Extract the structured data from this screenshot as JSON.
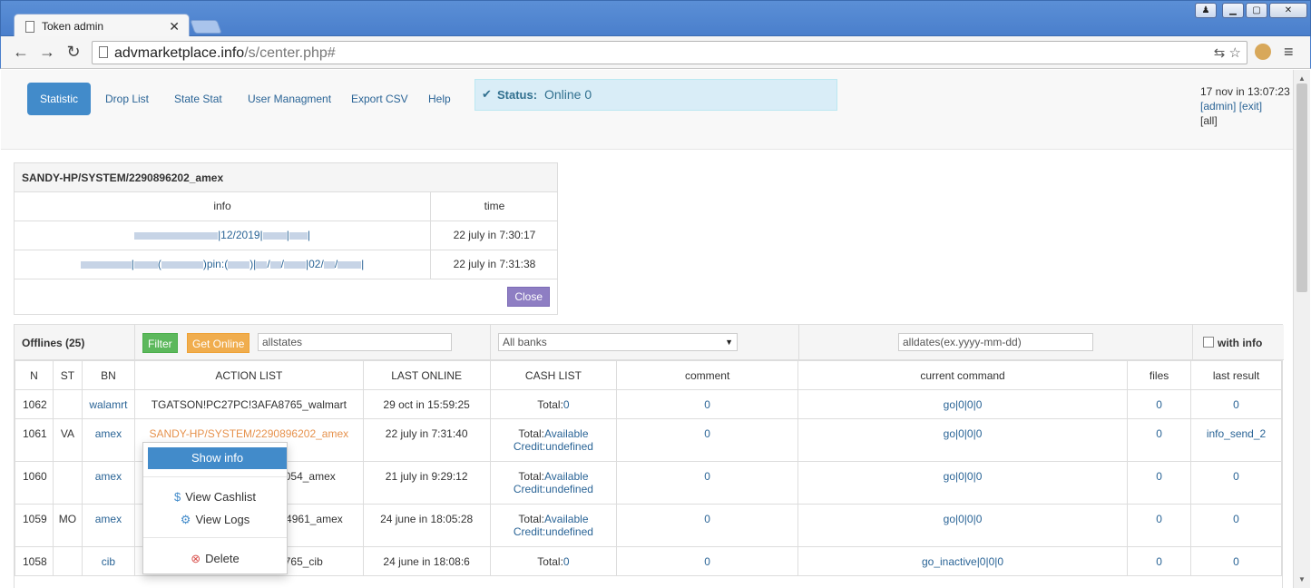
{
  "browser": {
    "tab_title": "Token admin",
    "url_host": "advmarketplace.info",
    "url_path": "/s/center.php#"
  },
  "nav": {
    "items": [
      "Statistic",
      "Drop List",
      "State Stat",
      "User Managment",
      "Export CSV",
      "Help"
    ],
    "status_label": "Status:",
    "status_value": "Online 0",
    "datetime": "17 nov in 13:07:23",
    "admin_link": "[admin]",
    "exit_link": "[exit]",
    "all_link": "[all]"
  },
  "info_panel": {
    "title": "SANDY-HP/SYSTEM/2290896202_amex",
    "col_info": "info",
    "col_time": "time",
    "rows": [
      {
        "info_segments": [
          "|12/2019|",
          "|",
          "|"
        ],
        "time": "22 july in 7:30:17"
      },
      {
        "info_segments": [
          "|",
          "(",
          ")pin:(",
          ")|",
          "/",
          "/",
          "|02/",
          "/",
          "|"
        ],
        "time": "22 july in 7:31:38"
      }
    ],
    "close_label": "Close"
  },
  "offlines": {
    "title": "Offlines (25)",
    "filter_label": "Filter",
    "get_online_label": "Get Online",
    "states_value": "allstates",
    "banks_value": "All banks",
    "dates_placeholder": "alldates(ex.yyyy-mm-dd)",
    "with_info_label": "with info",
    "columns": [
      "N",
      "ST",
      "BN",
      "ACTION LIST",
      "LAST ONLINE",
      "CASH LIST",
      "comment",
      "current command",
      "files",
      "last result"
    ],
    "rows": [
      {
        "n": "1062",
        "st": "",
        "bn": "walamrt",
        "action": "TGATSON!PC27PC!3AFA8765_walmart",
        "last_online": "29 oct in 15:59:25",
        "cash1_label": "Total:",
        "cash1_value": "0",
        "cash2_label": "",
        "cash2_value": "",
        "comment": "0",
        "command": "go|0|0|0",
        "files": "0",
        "result": "0"
      },
      {
        "n": "1061",
        "st": "VA",
        "bn": "amex",
        "action": "SANDY-HP/SYSTEM/2290896202_amex",
        "last_online": "22 july in 7:31:40",
        "cash1_label": "Total:",
        "cash1_value": "Available",
        "cash2_label": "Credit:",
        "cash2_value": "undefined",
        "comment": "0",
        "command": "go|0|0|0",
        "files": "0",
        "result": "info_send_2"
      },
      {
        "n": "1060",
        "st": "",
        "bn": "amex",
        "action": "7054_amex",
        "last_online": "21 july in 9:29:12",
        "cash1_label": "Total:",
        "cash1_value": "Available",
        "cash2_label": "Credit:",
        "cash2_value": "undefined",
        "comment": "0",
        "command": "go|0|0|0",
        "files": "0",
        "result": "0"
      },
      {
        "n": "1059",
        "st": "MO",
        "bn": "amex",
        "action": "044961_amex",
        "last_online": "24 june in 18:05:28",
        "cash1_label": "Total:",
        "cash1_value": "Available",
        "cash2_label": "Credit:",
        "cash2_value": "undefined",
        "comment": "0",
        "command": "go|0|0|0",
        "files": "0",
        "result": "0"
      },
      {
        "n": "1058",
        "st": "",
        "bn": "cib",
        "action": "8765_cib",
        "last_online": "24 june in 18:08:6",
        "cash1_label": "Total:",
        "cash1_value": "0",
        "cash2_label": "",
        "cash2_value": "",
        "comment": "0",
        "command": "go_inactive|0|0|0",
        "files": "0",
        "result": "0"
      }
    ]
  },
  "context_menu": {
    "show_info": "Show info",
    "view_cashlist": "View Cashlist",
    "view_logs": "View Logs",
    "delete": "Delete"
  },
  "colors": {
    "primary": "#428bca",
    "status_bg": "#d9edf7",
    "filter": "#5cb85c",
    "get_online": "#f0ad4e",
    "close_btn": "#8e7ec3",
    "delete_icon": "#d9534f",
    "action_highlight": "#e6924d"
  }
}
